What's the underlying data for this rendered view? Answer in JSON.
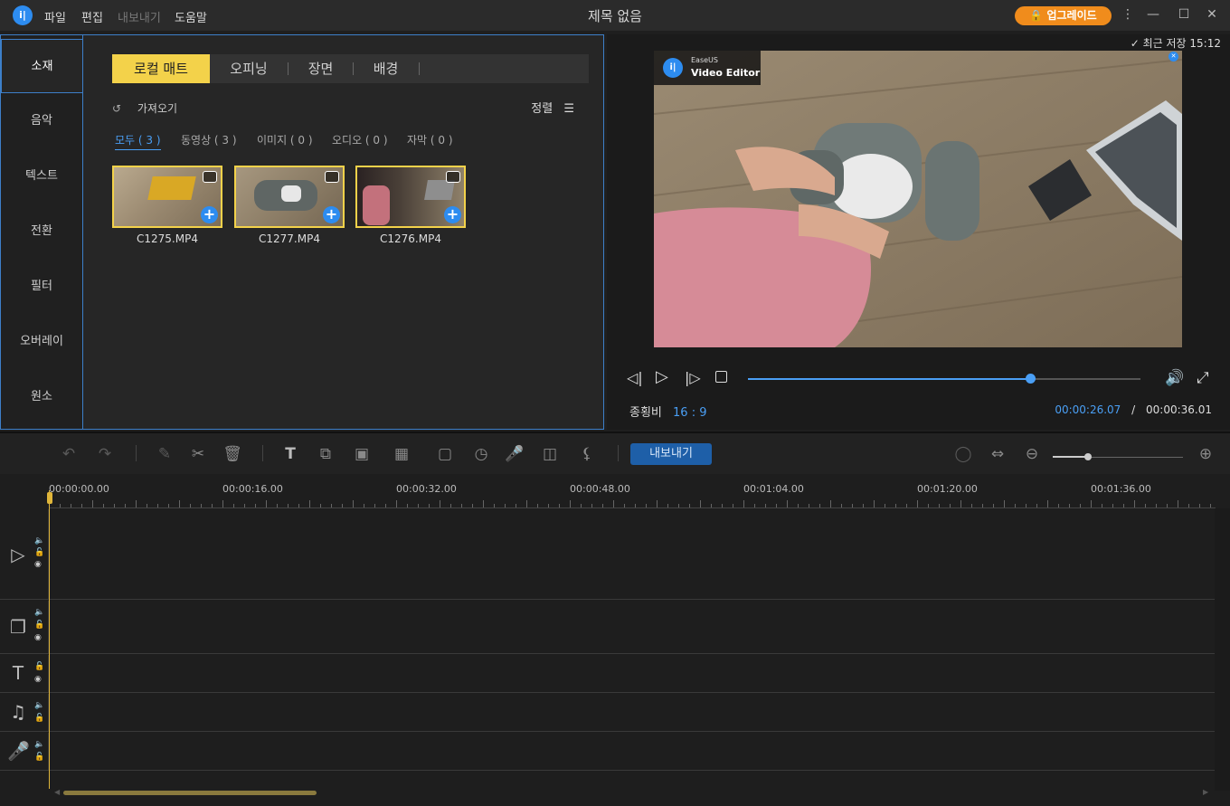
{
  "titlebar": {
    "logo": "i|",
    "menu": [
      "파일",
      "편집",
      "내보내기",
      "도움말"
    ],
    "title": "제목 없음",
    "upgrade": "업그레이드",
    "upgrade_icon": "lock-icon",
    "more_icon": "⋮",
    "minimize_icon": "—",
    "maximize_icon": "☐",
    "close_icon": "✕"
  },
  "sidebar": {
    "items": [
      "소재",
      "음악",
      "텍스트",
      "전환",
      "필터",
      "오버레이",
      "원소"
    ],
    "active": "소재"
  },
  "media": {
    "tabs": [
      "로컬 매트",
      "오피닝",
      "장면",
      "배경"
    ],
    "active_tab": "로컬 매트",
    "import_label": "가져오기",
    "sort_label": "정렬",
    "sort_icon": "☰",
    "filters": [
      "모두 ( 3 )",
      "동영상 ( 3 )",
      "이미지 ( 0 )",
      "오디오 ( 0 )",
      "자막 ( 0 )"
    ],
    "active_filter": "모두 ( 3 )",
    "files": [
      {
        "name": "C1275.MP4"
      },
      {
        "name": "C1277.MP4"
      },
      {
        "name": "C1276.MP4"
      }
    ],
    "add_glyph": "+"
  },
  "preview": {
    "saved": "최근 저장 15:12",
    "saved_icon": "✓",
    "watermark_brand": "EaseUS",
    "watermark_product": "Video Editor",
    "watermark_close": "✕",
    "aspect_label": "종횡비",
    "aspect_value": "16 : 9",
    "current_time": "00:00:26.07",
    "time_separator": "/",
    "total_time": "00:00:36.01",
    "progress": 0.72
  },
  "toolbar": {
    "export_label": "내보내기",
    "zoom_level": 0.27
  },
  "timeline": {
    "ruler_labels": [
      "00:00:00.00",
      "00:00:16.00",
      "00:00:32.00",
      "00:00:48.00",
      "00:01:04.00",
      "00:01:20.00",
      "00:01:36.00"
    ],
    "tracks": [
      "video-track",
      "overlay-track",
      "text-track",
      "music-track",
      "voice-track"
    ]
  },
  "colors": {
    "accent": "#4a9ff5",
    "highlight": "#f3d24a",
    "upgrade": "#f08c1c",
    "export_btn": "#1e5fa8"
  }
}
